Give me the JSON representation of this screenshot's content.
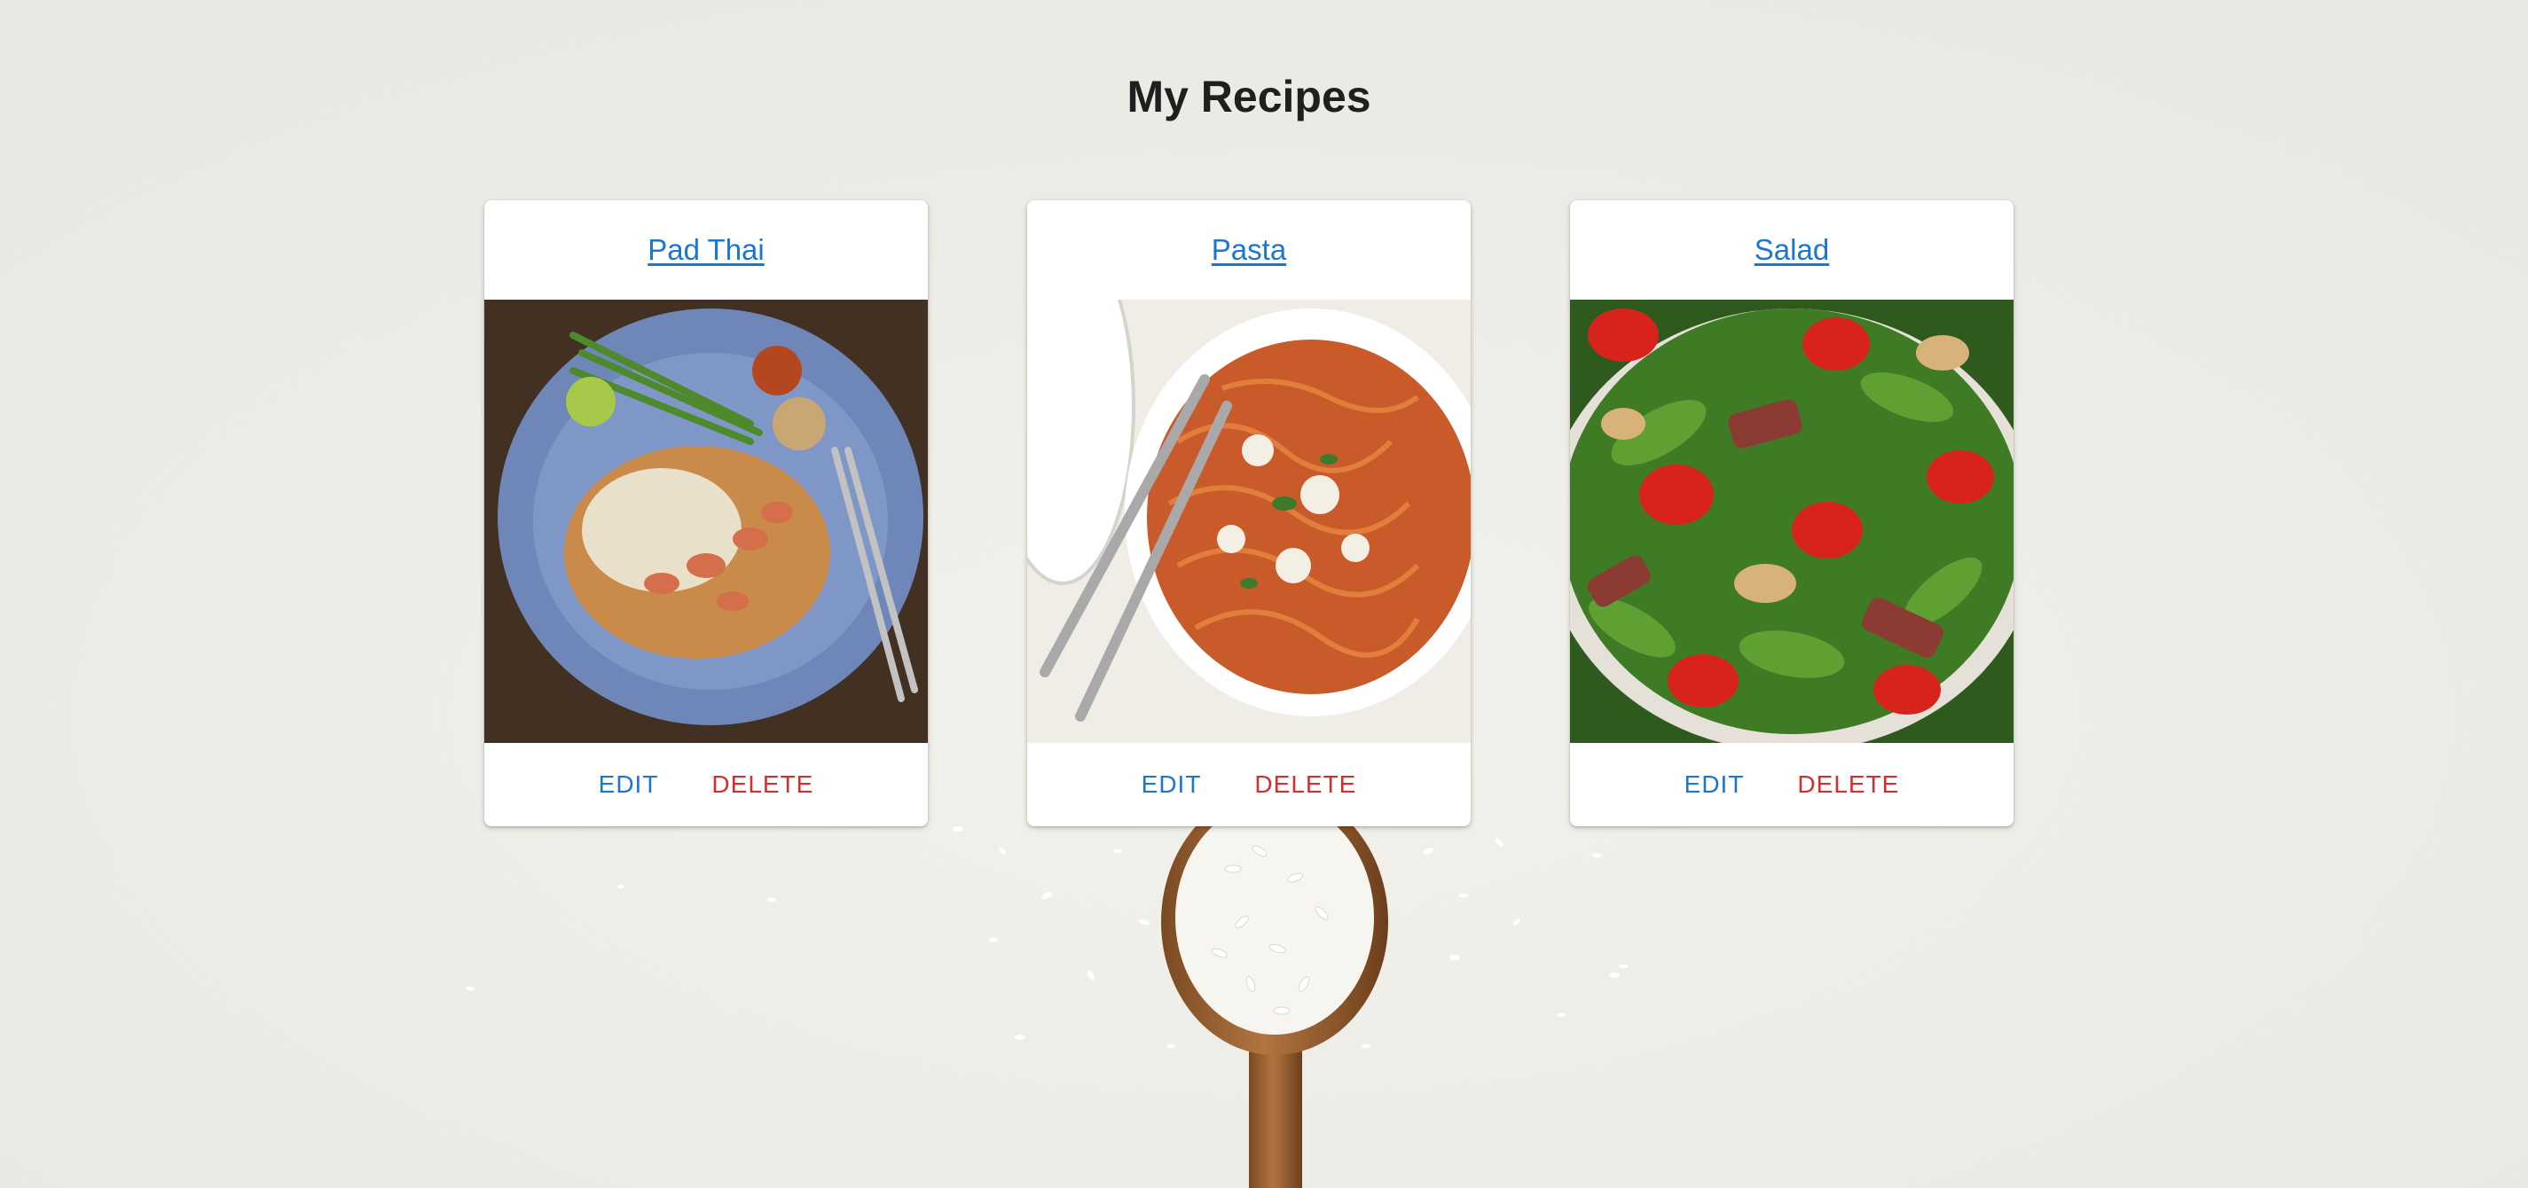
{
  "page": {
    "title": "My Recipes"
  },
  "recipes": [
    {
      "name": "Pad Thai",
      "image_icon": "pad-thai-photo",
      "edit_label": "EDIT",
      "delete_label": "DELETE"
    },
    {
      "name": "Pasta",
      "image_icon": "pasta-photo",
      "edit_label": "EDIT",
      "delete_label": "DELETE"
    },
    {
      "name": "Salad",
      "image_icon": "salad-photo",
      "edit_label": "EDIT",
      "delete_label": "DELETE"
    }
  ],
  "colors": {
    "background": "#eeede8",
    "link": "#1976d2",
    "danger": "#d32f2f",
    "title": "#1f1f1f"
  }
}
